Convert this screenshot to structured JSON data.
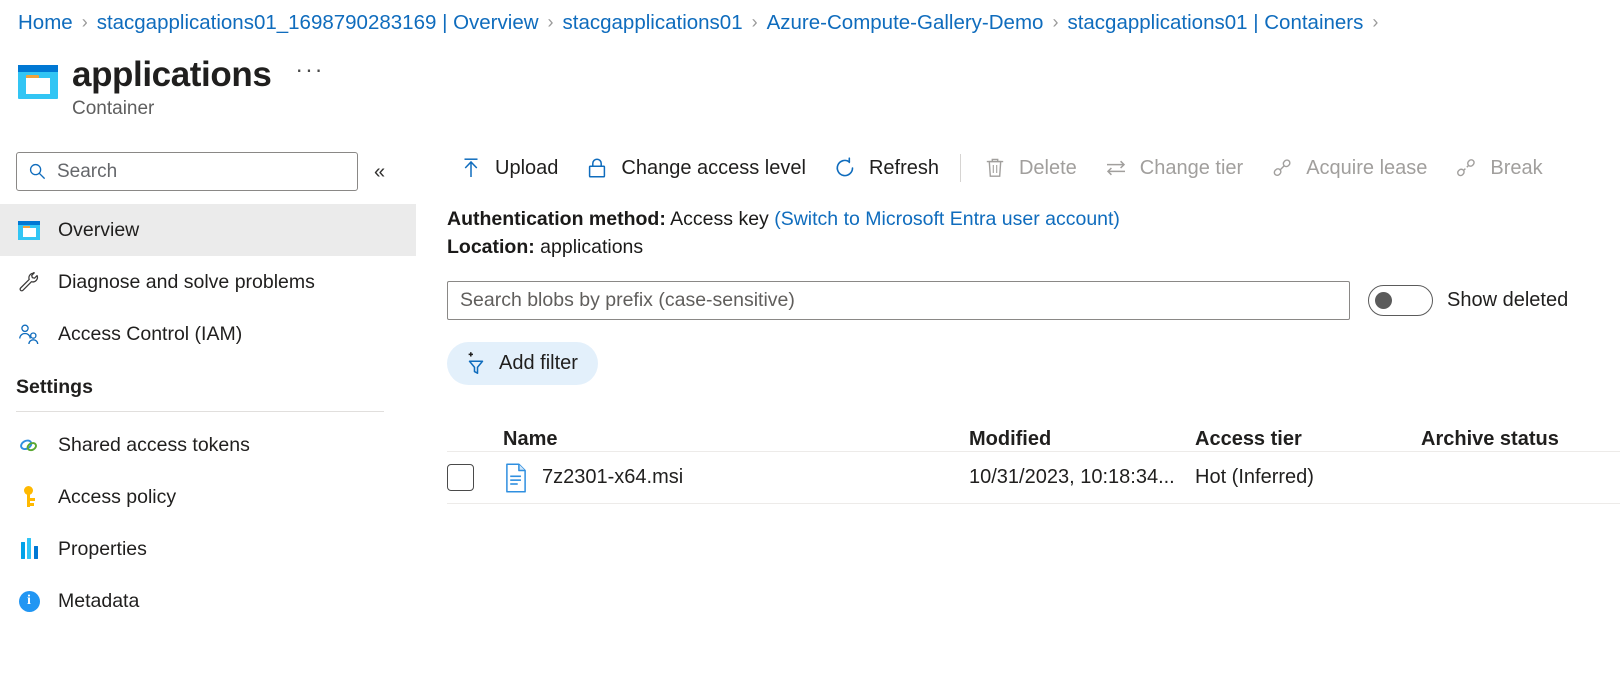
{
  "breadcrumb": {
    "separator": "›",
    "items": [
      {
        "label": "Home"
      },
      {
        "label": "stacgapplications01_1698790283169 | Overview"
      },
      {
        "label": "stacgapplications01"
      },
      {
        "label": "Azure-Compute-Gallery-Demo"
      },
      {
        "label": "stacgapplications01 | Containers"
      }
    ],
    "trailing_separator": "›"
  },
  "header": {
    "title": "applications",
    "subtitle": "Container",
    "more_label": "···",
    "icon": "container-icon"
  },
  "sidebar": {
    "search": {
      "placeholder": "Search",
      "value": "",
      "icon": "search-icon"
    },
    "collapse_label": "«",
    "items": [
      {
        "label": "Overview",
        "icon": "container-icon",
        "selected": true
      },
      {
        "label": "Diagnose and solve problems",
        "icon": "wrench-icon",
        "selected": false
      },
      {
        "label": "Access Control (IAM)",
        "icon": "people-icon",
        "selected": false
      }
    ],
    "section": {
      "title": "Settings"
    },
    "settings_items": [
      {
        "label": "Shared access tokens",
        "icon": "link-rings-icon"
      },
      {
        "label": "Access policy",
        "icon": "key-icon"
      },
      {
        "label": "Properties",
        "icon": "properties-bars-icon"
      },
      {
        "label": "Metadata",
        "icon": "info-circle-icon"
      }
    ]
  },
  "toolbar": {
    "items": [
      {
        "label": "Upload",
        "icon": "upload-arrow-icon",
        "disabled": false
      },
      {
        "label": "Change access level",
        "icon": "lock-icon",
        "disabled": false
      },
      {
        "label": "Refresh",
        "icon": "refresh-icon",
        "disabled": false
      },
      {
        "label": "Delete",
        "icon": "trash-icon",
        "disabled": true
      },
      {
        "label": "Change tier",
        "icon": "swap-arrows-icon",
        "disabled": true
      },
      {
        "label": "Acquire lease",
        "icon": "plug-icon",
        "disabled": true
      },
      {
        "label": "Break",
        "icon": "broken-plug-icon",
        "disabled": true
      }
    ]
  },
  "info": {
    "auth_label": "Authentication method:",
    "auth_value": "Access key",
    "auth_switch_link": "(Switch to Microsoft Entra user account)",
    "location_label": "Location:",
    "location_value": "applications"
  },
  "filters": {
    "blob_search_placeholder": "Search blobs by prefix (case-sensitive)",
    "blob_search_value": "",
    "show_deleted_label": "Show deleted",
    "show_deleted_on": false,
    "add_filter_label": "Add filter",
    "add_filter_icon": "funnel-plus-icon"
  },
  "table": {
    "columns": [
      "Name",
      "Modified",
      "Access tier",
      "Archive status"
    ],
    "rows": [
      {
        "name": "7z2301-x64.msi",
        "modified": "10/31/2023, 10:18:34...",
        "access_tier": "Hot (Inferred)",
        "archive_status": "",
        "icon": "file-document-icon",
        "checked": false
      }
    ]
  },
  "colors": {
    "link": "#0f6cbd",
    "accent": "#0078d4",
    "container_body": "#32c5f4",
    "selected_row": "#ebebeb",
    "add_filter_bg": "#e3f0fb"
  }
}
